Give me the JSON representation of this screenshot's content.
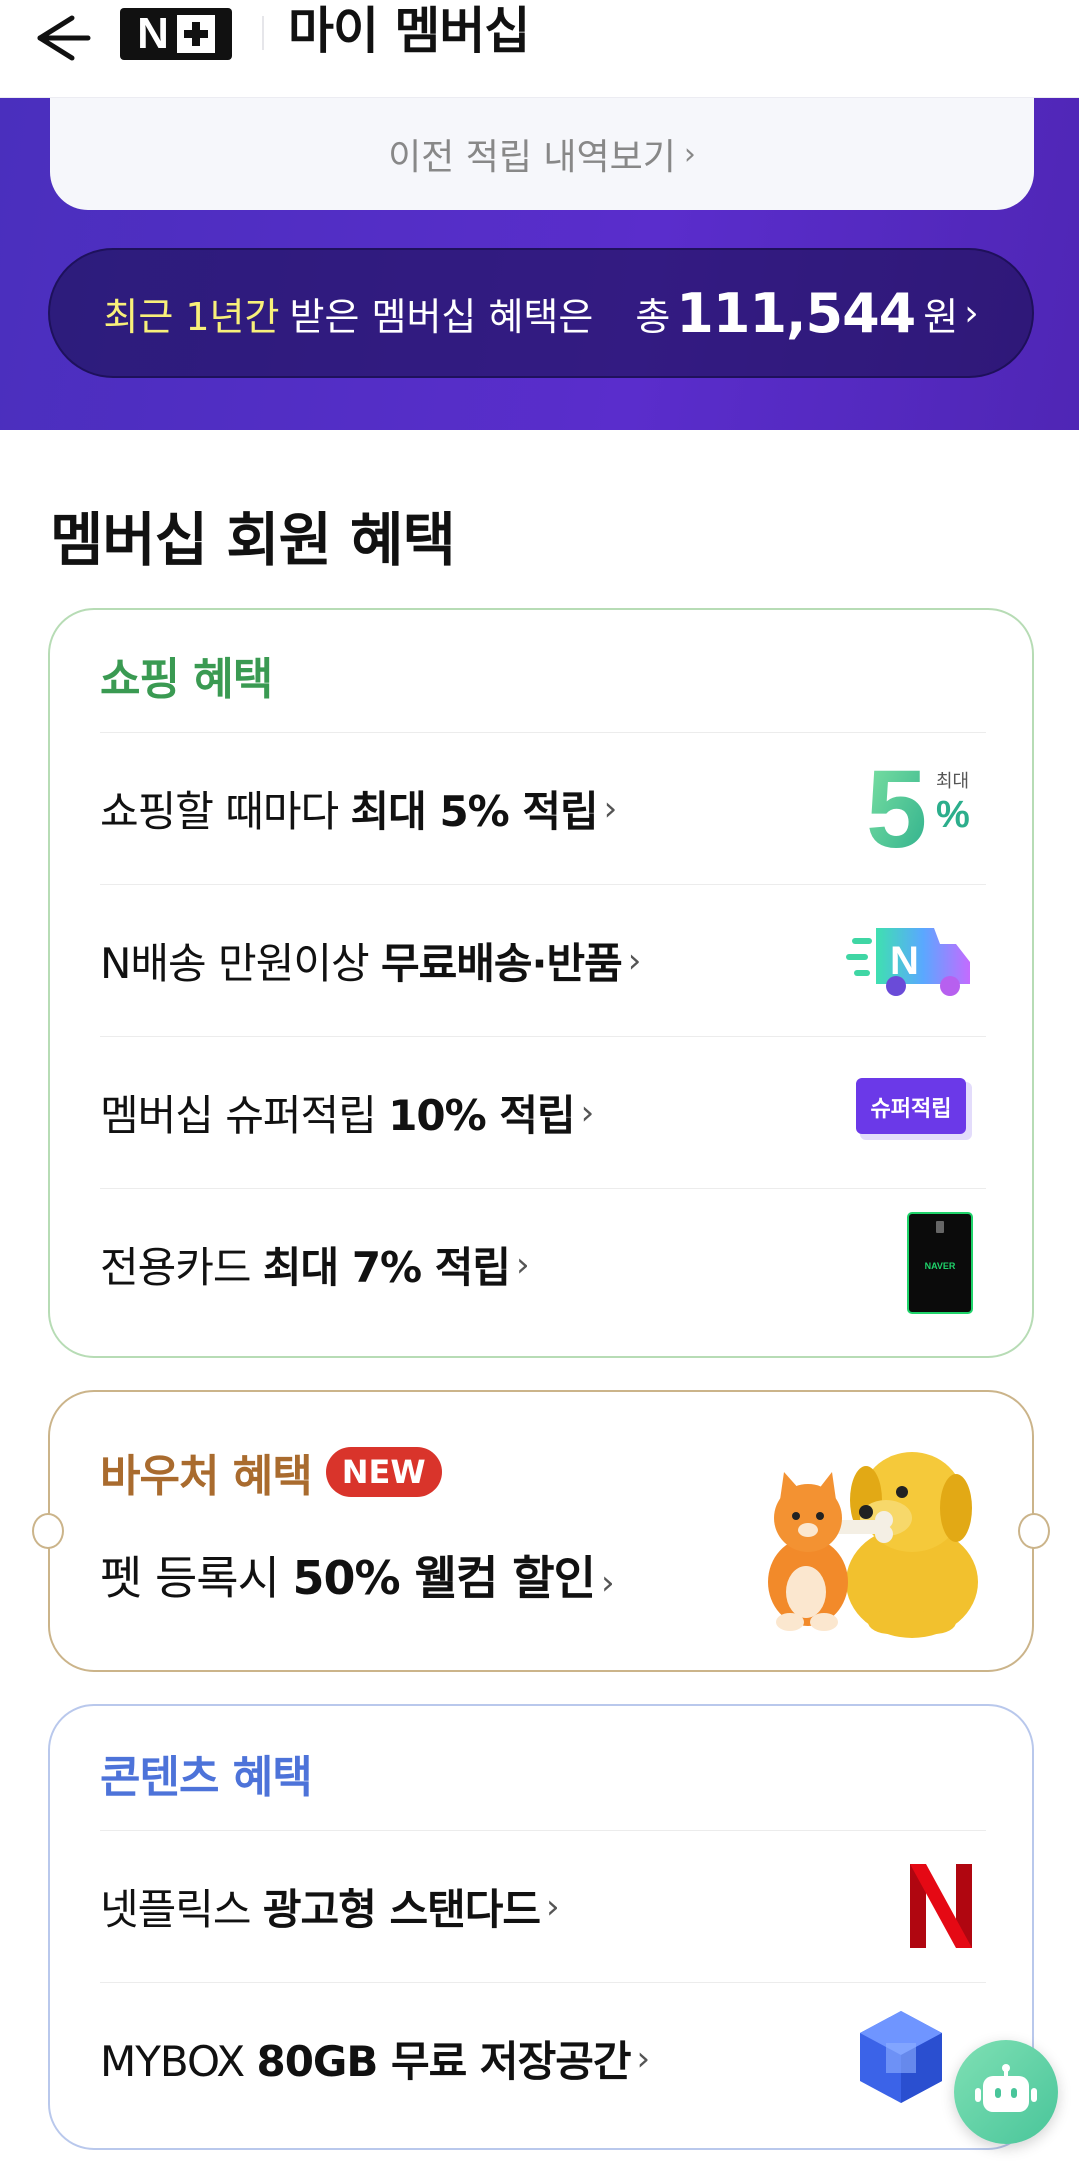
{
  "header": {
    "title": "마이 멤버십",
    "brand_n": "N"
  },
  "hero": {
    "prev_link": "이전 적립 내역보기",
    "summary": {
      "highlight": "최근 1년간",
      "mid": "받은 멤버십 혜택은",
      "total_prefix": "총",
      "amount": "111,544",
      "unit": "원"
    }
  },
  "section_title": "멤버십 회원 혜택",
  "shopping": {
    "title": "쇼핑 혜택",
    "rows": [
      {
        "text": "쇼핑할 때마다 ",
        "bold": "최대 5% 적립",
        "icon": "five-percent-icon"
      },
      {
        "text": "N배송 만원이상 ",
        "bold": "무료배송·반품",
        "icon": "n-delivery-truck-icon"
      },
      {
        "text": "멤버십 슈퍼적립 ",
        "bold": "10% 적립",
        "icon": "super-reward-badge-icon"
      },
      {
        "text": "전용카드 ",
        "bold": "최대 7% 적립",
        "icon": "naver-card-icon"
      }
    ],
    "icon_labels": {
      "five": "5",
      "five_max": "최대",
      "five_pct": "%",
      "super": "슈퍼적립",
      "card": "NAVER"
    }
  },
  "voucher": {
    "title": "바우처 혜택",
    "badge": "NEW",
    "text": "펫 등록시 ",
    "bold": "50% 웰컴 할인"
  },
  "content_benefits": {
    "title": "콘텐츠 혜택",
    "rows": [
      {
        "text": "넷플릭스 ",
        "bold": "광고형 스탠다드",
        "icon": "netflix-logo-icon"
      },
      {
        "text": "MYBOX ",
        "bold": "80GB 무료 저장공간",
        "icon": "mybox-cube-icon"
      }
    ]
  },
  "colors": {
    "hero_purple": "#5a2dcc",
    "highlight_yellow": "#f8f07a",
    "shop_green": "#3a9a52",
    "voucher_brown": "#a96b2e",
    "new_red": "#d9342b",
    "content_blue": "#4d73d9"
  }
}
